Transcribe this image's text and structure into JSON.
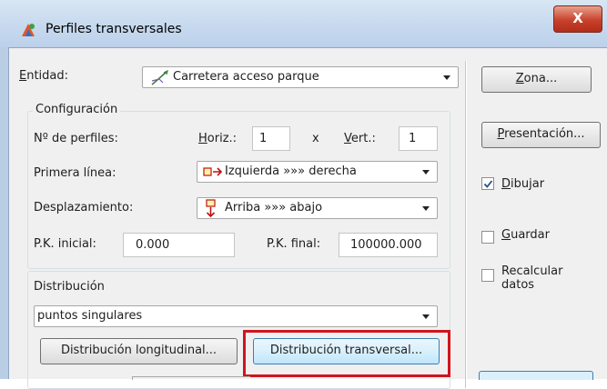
{
  "window": {
    "title": "Perfiles transversales",
    "close_label": "X"
  },
  "entidad": {
    "label_underline": "E",
    "label_rest": "ntidad:",
    "value": "Carretera acceso parque"
  },
  "configuracion": {
    "title": "Configuración",
    "num_perfiles_label": "Nº de perfiles:",
    "horiz_label_underline": "H",
    "horiz_label_rest": "oriz.:",
    "horiz_value": "1",
    "x_sep": "x",
    "vert_label_underline": "V",
    "vert_label_rest": "ert.:",
    "vert_value": "1",
    "primera_linea_label": "Primera línea:",
    "primera_linea_value": "Izquierda »»» derecha",
    "desplazamiento_label": "Desplazamiento:",
    "desplazamiento_value": "Arriba »»» abajo",
    "pk_inicial_label": "P.K. inicial:",
    "pk_inicial_value": "0.000",
    "pk_final_label": "P.K. final:",
    "pk_final_value": "100000.000"
  },
  "distribucion": {
    "title": "Distribución",
    "value": "puntos singulares",
    "longitudinal_button": "Distribución longitudinal...",
    "transversal_button": "Distribución transversal..."
  },
  "side": {
    "zona_underline": "Z",
    "zona_rest": "ona...",
    "presentacion_underline": "P",
    "presentacion_rest": "resentación...",
    "dibujar_underline": "D",
    "dibujar_rest": "ibujar",
    "dibujar_checked": true,
    "guardar_underline": "G",
    "guardar_rest": "uardar",
    "guardar_checked": false,
    "recalcular_line1": "Recalcular",
    "recalcular_line2": "datos",
    "recalcular_checked": false
  },
  "colors": {
    "highlight": "#d0141e",
    "check_mark": "#2a4e8a"
  }
}
